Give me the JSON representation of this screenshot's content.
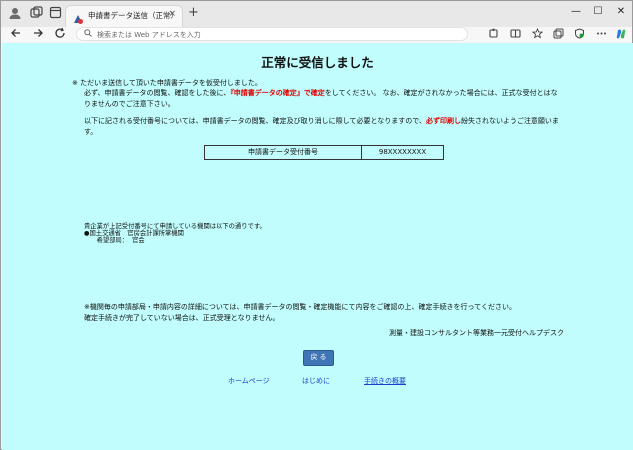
{
  "browser": {
    "tab_title": "申請書データ送信（正常）",
    "tab_close": "×",
    "new_tab": "+",
    "window_minimize": "—",
    "window_maximize": "☐",
    "window_close": "✕",
    "address_placeholder": "検索または Web アドレスを入力",
    "icons": [
      "profile-icon",
      "workspaces-icon",
      "tab-actions-icon",
      "back-icon",
      "forward-icon",
      "refresh-icon",
      "search-icon",
      "extensions-icon",
      "split-screen-icon",
      "favorite-icon",
      "collections-icon",
      "sidebar-icon",
      "browser-essentials-icon",
      "more-icon",
      "copilot-icon"
    ]
  },
  "page": {
    "title": "正常に受信しました",
    "notice": {
      "line1": "※ ただいま送信して頂いた申請書データを仮受付しました。",
      "line2_a": "必ず、申請書データの閲覧、確認をした後に、",
      "line2_red1": "『申請書データの確定』で確定",
      "line2_b": "をしてください。 なお、確定がされなかった場合には、正式な受付とはな",
      "line3": "りませんのでご注意下さい。",
      "line4_a": "以下に記される受付番号については、申請書データの閲覧、確定及び取り消しに際して必要となりますので、",
      "line4_red": "必ず印刷し",
      "line4_b": "紛失されないようご注意願いま",
      "line5": "す。"
    },
    "receipt": {
      "label": "申請書データ受付番号",
      "value": "98XXXXXXXX"
    },
    "agency": {
      "line1": "貴企業が上記受付番号にて申請している機関は以下の通りです。",
      "line2": "●国土交通省　官房会計課所掌機関",
      "line3": "　　希望部局：  官会"
    },
    "footer_note": {
      "line1": "※機関毎の申請部局・申請内容の詳細については、申請書データの閲覧・確定機能にて内容をご確認の上、確定手続きを行ってください。",
      "line2": "確定手続きが完了していない場合は、正式受理となりません。"
    },
    "helpdesk": "測量・建設コンサルタント等業務一元受付ヘルプデスク",
    "back_button": "戻 る",
    "links": {
      "home": "ホームページ",
      "intro": "はじめに",
      "overview": "手続きの概要"
    }
  },
  "colors": {
    "content_bg": "#c0fdfc",
    "accent_red": "#e00000",
    "button_blue": "#3f74b5",
    "link_blue": "#1a3fd0"
  }
}
